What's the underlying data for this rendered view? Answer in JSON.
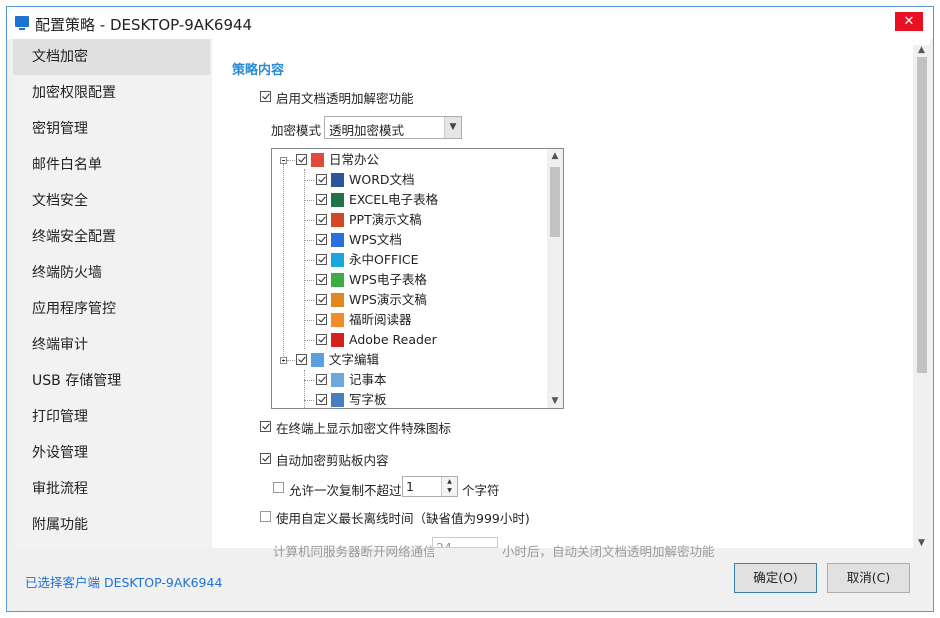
{
  "window": {
    "title": "配置策略 - DESKTOP-9AK6944",
    "close_glyph": "✕"
  },
  "sidebar": {
    "items": [
      {
        "label": "文档加密",
        "active": true
      },
      {
        "label": "加密权限配置"
      },
      {
        "label": "密钥管理"
      },
      {
        "label": "邮件白名单"
      },
      {
        "label": "文档安全"
      },
      {
        "label": "终端安全配置"
      },
      {
        "label": "终端防火墙"
      },
      {
        "label": "应用程序管控"
      },
      {
        "label": "终端审计"
      },
      {
        "label": "USB 存储管理"
      },
      {
        "label": "打印管理"
      },
      {
        "label": "外设管理"
      },
      {
        "label": "审批流程"
      },
      {
        "label": "附属功能"
      }
    ]
  },
  "content": {
    "section_title": "策略内容",
    "enable_encryption": {
      "label": "启用文档透明加解密功能",
      "checked": true
    },
    "mode": {
      "label": "加密模式",
      "value": "透明加密模式"
    },
    "tree": [
      {
        "label": "日常办公",
        "level": 0,
        "icon": "folder-office-icon",
        "color": "#e04a3a"
      },
      {
        "label": "WORD文档",
        "level": 1,
        "icon": "word-icon",
        "color": "#2b579a"
      },
      {
        "label": "EXCEL电子表格",
        "level": 1,
        "icon": "excel-icon",
        "color": "#217346"
      },
      {
        "label": "PPT演示文稿",
        "level": 1,
        "icon": "ppt-icon",
        "color": "#d24726"
      },
      {
        "label": "WPS文档",
        "level": 1,
        "icon": "wps-writer-icon",
        "color": "#2a6fdb"
      },
      {
        "label": "永中OFFICE",
        "level": 1,
        "icon": "yozo-icon",
        "color": "#19a7e0"
      },
      {
        "label": "WPS电子表格",
        "level": 1,
        "icon": "wps-sheet-icon",
        "color": "#3daa43"
      },
      {
        "label": "WPS演示文稿",
        "level": 1,
        "icon": "wps-ppt-icon",
        "color": "#e08a1e"
      },
      {
        "label": "福昕阅读器",
        "level": 1,
        "icon": "foxit-icon",
        "color": "#f28c28"
      },
      {
        "label": "Adobe Reader",
        "level": 1,
        "icon": "adobe-reader-icon",
        "color": "#d4221b"
      },
      {
        "label": "文字编辑",
        "level": 0,
        "icon": "text-edit-icon",
        "color": "#5aa0e0"
      },
      {
        "label": "记事本",
        "level": 1,
        "icon": "notepad-icon",
        "color": "#6fa8dc"
      },
      {
        "label": "写字板",
        "level": 1,
        "icon": "wordpad-icon",
        "color": "#4a7ebb"
      }
    ],
    "show_icon": {
      "label": "在终端上显示加密文件特殊图标",
      "checked": true
    },
    "auto_clipboard": {
      "label": "自动加密剪贴板内容",
      "checked": true
    },
    "copy_limit": {
      "label_pre": "允许一次复制不超过",
      "value": "1",
      "label_post": "个字符",
      "checked": false
    },
    "custom_offline": {
      "label": "使用自定义最长离线时间（缺省值为999小时)",
      "checked": false
    },
    "offline_hours": {
      "label_pre": "计算机同服务器断开网络通信",
      "value": "24",
      "label_post": "小时后，自动关闭文档透明加解密功能"
    }
  },
  "footer": {
    "selected_client": "已选择客户端 DESKTOP-9AK6944",
    "ok_label": "确定(O)",
    "cancel_label": "取消(C)"
  },
  "colors": {
    "accent": "#2a8bd4",
    "close": "#e81123",
    "link": "#1e73d2"
  }
}
